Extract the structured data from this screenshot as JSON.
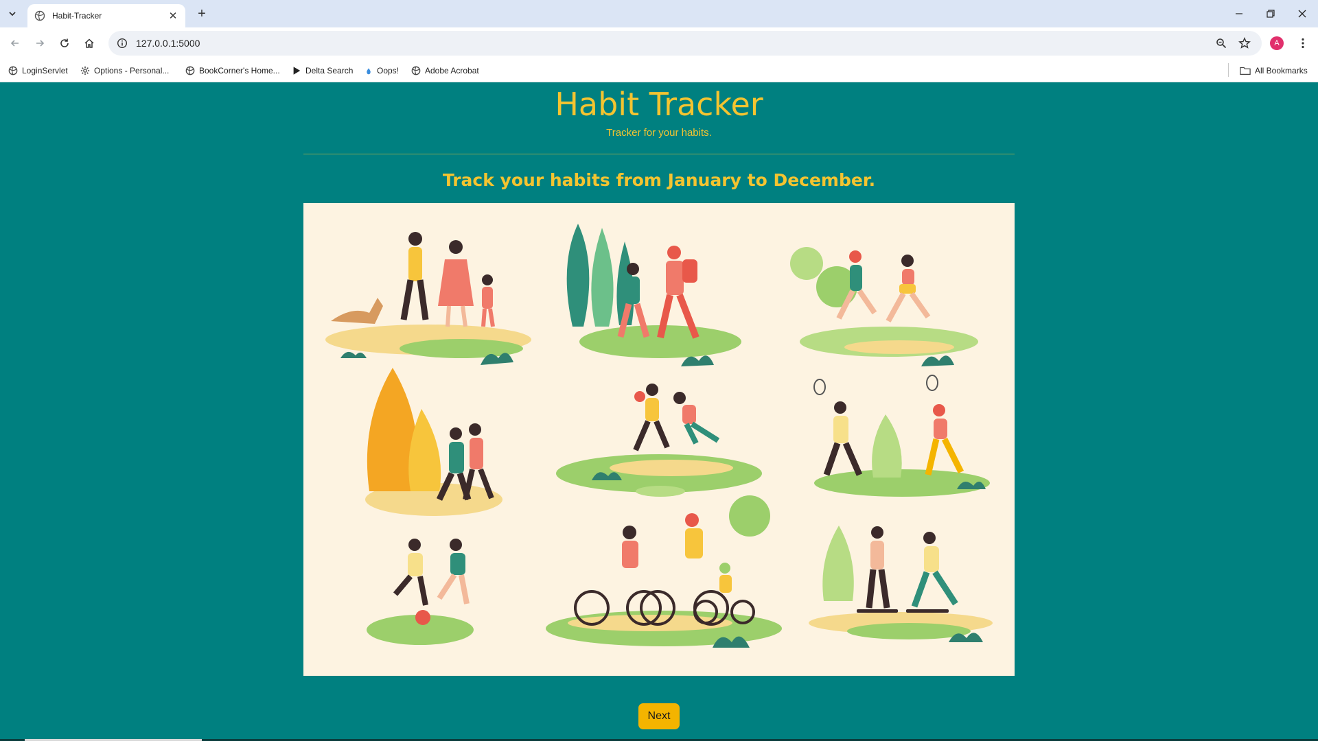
{
  "browser": {
    "tab_title": "Habit-Tracker",
    "url": "127.0.0.1:5000",
    "profile_initial": "A",
    "bookmarks": [
      {
        "label": "LoginServlet",
        "icon": "globe-icon"
      },
      {
        "label": "Options - Personal...",
        "icon": "gear-icon"
      },
      {
        "label": "BookCorner's Home...",
        "icon": "globe-icon"
      },
      {
        "label": "Delta Search",
        "icon": "play-icon"
      },
      {
        "label": "Oops!",
        "icon": "drop-icon"
      },
      {
        "label": "Adobe Acrobat",
        "icon": "globe-icon"
      }
    ],
    "all_bookmarks": "All Bookmarks"
  },
  "page": {
    "title": "Habit Tracker",
    "subtitle": "Tracker for your habits.",
    "heading": "Track your habits from January to December.",
    "hero_alt": "illustration of people walking, hiking, running, playing basketball, badminton, football, cycling and skateboarding",
    "next_label": "Next"
  },
  "colors": {
    "page_bg": "#008080",
    "accent_text": "#f4c430",
    "button_bg": "#f4b400",
    "hero_bg": "#fdf3e1"
  }
}
